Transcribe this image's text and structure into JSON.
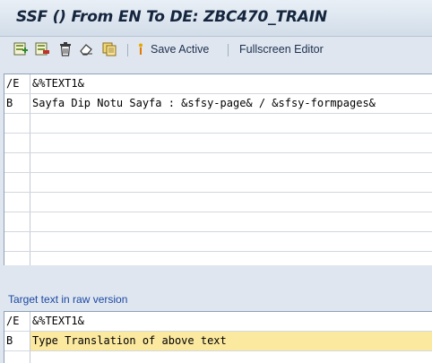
{
  "window": {
    "title": "SSF () From EN To DE: ZBC470_TRAIN"
  },
  "toolbar": {
    "icons": [
      "insert-row-icon",
      "delete-row-icon",
      "trash-icon",
      "eraser-icon",
      "copy-icon"
    ],
    "save_active_label": "Save Active",
    "fullscreen_editor_label": "Fullscreen Editor"
  },
  "source_editor": {
    "rows": [
      {
        "marker": "/E",
        "text": "&%TEXT1&"
      },
      {
        "marker": "B",
        "text": "Sayfa Dip Notu Sayfa : &sfsy-page& / &sfsy-formpages&"
      },
      {
        "marker": "",
        "text": ""
      },
      {
        "marker": "",
        "text": ""
      },
      {
        "marker": "",
        "text": ""
      },
      {
        "marker": "",
        "text": ""
      },
      {
        "marker": "",
        "text": ""
      },
      {
        "marker": "",
        "text": ""
      },
      {
        "marker": "",
        "text": ""
      },
      {
        "marker": "",
        "text": ""
      }
    ]
  },
  "target_label": "Target text in raw version",
  "target_editor": {
    "rows": [
      {
        "marker": "/E",
        "text": "&%TEXT1&"
      },
      {
        "marker": "B",
        "text": "Type Translation of above text"
      },
      {
        "marker": "",
        "text": ""
      }
    ]
  },
  "colors": {
    "background": "#dfe6ef",
    "title_text": "#14253d",
    "link_blue": "#1c48a4",
    "highlight_row": "#fbe9a0"
  }
}
